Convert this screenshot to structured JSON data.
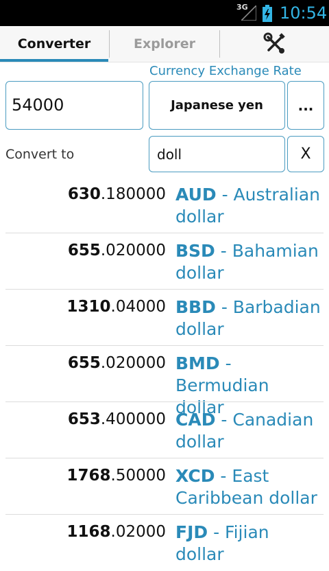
{
  "status": {
    "network": "3G",
    "time": "10:54"
  },
  "tabs": {
    "converter": "Converter",
    "explorer": "Explorer"
  },
  "converter": {
    "rate_link": "Currency Exchange Rate",
    "amount": "54000",
    "from_currency": "Japanese yen",
    "more_label": "...",
    "convert_to_label": "Convert to",
    "filter": "doll",
    "clear_label": "X"
  },
  "results": [
    {
      "int": "630",
      "frac": ".180000",
      "code": "AUD",
      "name": " - Australian dollar"
    },
    {
      "int": "655",
      "frac": ".020000",
      "code": "BSD",
      "name": " - Bahamian dollar"
    },
    {
      "int": "1310",
      "frac": ".04000",
      "code": "BBD",
      "name": " - Barbadian dollar"
    },
    {
      "int": "655",
      "frac": ".020000",
      "code": "BMD",
      "name": " - Bermudian dollar"
    },
    {
      "int": "653",
      "frac": ".400000",
      "code": "CAD",
      "name": " - Canadian dollar"
    },
    {
      "int": "1768",
      "frac": ".50000",
      "code": "XCD",
      "name": " - East Caribbean dollar"
    },
    {
      "int": "1168",
      "frac": ".02000",
      "code": "FJD",
      "name": " - Fijian dollar"
    }
  ],
  "colors": {
    "accent": "#2a8ab8",
    "status_time": "#33b5e5"
  },
  "icons": {
    "tools_tab": "wrench-screwdriver-icon",
    "battery": "battery-charging-icon",
    "signal": "signal-icon"
  }
}
